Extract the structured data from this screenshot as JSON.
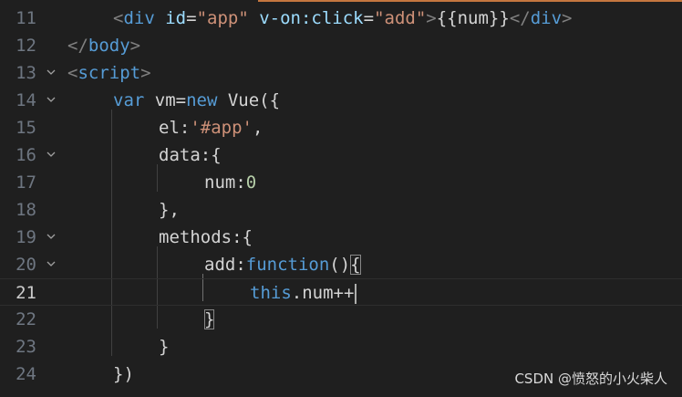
{
  "lines": [
    {
      "n": "11",
      "fold": "",
      "tokens": [
        {
          "c": "tag-bracket",
          "t": "<"
        },
        {
          "c": "tag",
          "t": "div"
        },
        {
          "c": "plain",
          "t": " "
        },
        {
          "c": "attr",
          "t": "id"
        },
        {
          "c": "plain",
          "t": "="
        },
        {
          "c": "str",
          "t": "\"app\""
        },
        {
          "c": "plain",
          "t": " "
        },
        {
          "c": "attr",
          "t": "v-on:click"
        },
        {
          "c": "plain",
          "t": "="
        },
        {
          "c": "str",
          "t": "\"add\""
        },
        {
          "c": "tag-bracket",
          "t": ">"
        },
        {
          "c": "plain",
          "t": "{{num}}"
        },
        {
          "c": "tag-bracket",
          "t": "</"
        },
        {
          "c": "tag",
          "t": "div"
        },
        {
          "c": "tag-bracket",
          "t": ">"
        }
      ]
    },
    {
      "n": "12",
      "fold": "",
      "tokens": [
        {
          "c": "tag-bracket",
          "t": "</"
        },
        {
          "c": "tag",
          "t": "body"
        },
        {
          "c": "tag-bracket",
          "t": ">"
        }
      ]
    },
    {
      "n": "13",
      "fold": "chevron-down",
      "tokens": [
        {
          "c": "tag-bracket",
          "t": "<"
        },
        {
          "c": "tag",
          "t": "script"
        },
        {
          "c": "tag-bracket",
          "t": ">"
        }
      ]
    },
    {
      "n": "14",
      "fold": "chevron-down",
      "tokens": [
        {
          "c": "kw",
          "t": "var"
        },
        {
          "c": "plain",
          "t": " vm="
        },
        {
          "c": "kw",
          "t": "new"
        },
        {
          "c": "plain",
          "t": " Vue({"
        }
      ]
    },
    {
      "n": "15",
      "fold": "",
      "tokens": [
        {
          "c": "plain",
          "t": "el:"
        },
        {
          "c": "str",
          "t": "'#app'"
        },
        {
          "c": "plain",
          "t": ","
        }
      ]
    },
    {
      "n": "16",
      "fold": "chevron-down",
      "tokens": [
        {
          "c": "plain",
          "t": "data:{"
        }
      ]
    },
    {
      "n": "17",
      "fold": "",
      "tokens": [
        {
          "c": "plain",
          "t": "num:"
        },
        {
          "c": "num",
          "t": "0"
        }
      ]
    },
    {
      "n": "18",
      "fold": "",
      "tokens": [
        {
          "c": "plain",
          "t": "},"
        }
      ]
    },
    {
      "n": "19",
      "fold": "chevron-down",
      "tokens": [
        {
          "c": "plain",
          "t": "methods:{"
        }
      ]
    },
    {
      "n": "20",
      "fold": "chevron-down",
      "tokens": [
        {
          "c": "plain",
          "t": "add:"
        },
        {
          "c": "kw",
          "t": "function"
        },
        {
          "c": "plain",
          "t": "()"
        },
        {
          "c": "plain",
          "t": "{",
          "box": true
        }
      ]
    },
    {
      "n": "21",
      "fold": "",
      "current": true,
      "tokens": [
        {
          "c": "kw",
          "t": "this"
        },
        {
          "c": "plain",
          "t": ".num++"
        }
      ]
    },
    {
      "n": "22",
      "fold": "",
      "tokens": [
        {
          "c": "plain",
          "t": "}",
          "box": true
        }
      ]
    },
    {
      "n": "23",
      "fold": "",
      "tokens": [
        {
          "c": "plain",
          "t": "}"
        }
      ]
    },
    {
      "n": "24",
      "fold": "",
      "tokens": [
        {
          "c": "plain",
          "t": "})"
        }
      ]
    }
  ],
  "watermark": "CSDN @愤怒的小火柴人",
  "colors": {
    "background": "#1f1f1f",
    "tag": "#569cd6",
    "attribute": "#9cdcfe",
    "string": "#ce9178",
    "number": "#b5cea8",
    "line_number": "#6e7681"
  }
}
